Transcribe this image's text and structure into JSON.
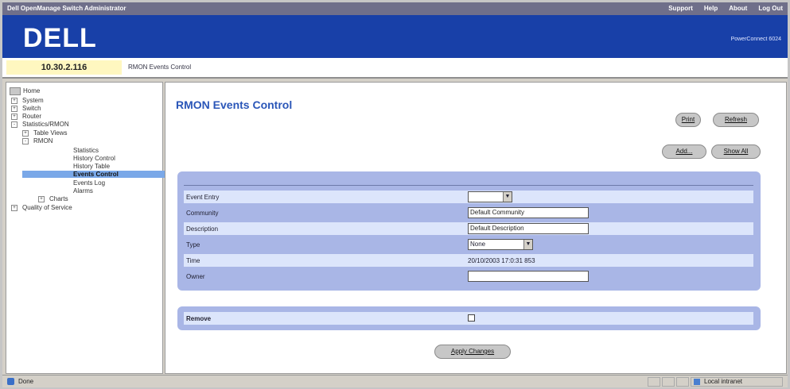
{
  "window": {
    "title": "Dell OpenManage Switch Administrator",
    "links": [
      "Support",
      "Help",
      "About",
      "Log Out"
    ]
  },
  "brand": {
    "logo": "DELL",
    "model": "PowerConnect 6024"
  },
  "address": {
    "ip": "10.30.2.116",
    "breadcrumb": "RMON Events Control"
  },
  "tree": {
    "root": "Home",
    "items": [
      {
        "label": "System",
        "expander": "+"
      },
      {
        "label": "Switch",
        "expander": "+"
      },
      {
        "label": "Router",
        "expander": "+"
      },
      {
        "label": "Statistics/RMON",
        "expander": "-"
      },
      {
        "label": "Table Views",
        "expander": "+"
      },
      {
        "label": "RMON",
        "expander": "-"
      },
      {
        "label": "Statistics"
      },
      {
        "label": "History Control"
      },
      {
        "label": "History Table"
      },
      {
        "label": "Events Control",
        "selected": true
      },
      {
        "label": "Events Log"
      },
      {
        "label": "Alarms"
      },
      {
        "label": "Charts",
        "expander": "+"
      },
      {
        "label": "Quality of Service",
        "expander": "+"
      }
    ]
  },
  "page": {
    "title": "RMON Events Control",
    "buttons": {
      "print": "Print",
      "refresh": "Refresh",
      "add": "Add...",
      "show_all": "Show All",
      "apply": "Apply Changes"
    }
  },
  "form": {
    "event_entry": {
      "label": "Event Entry",
      "value": ""
    },
    "community": {
      "label": "Community",
      "value": "Default Community"
    },
    "description": {
      "label": "Description",
      "value": "Default Description"
    },
    "type": {
      "label": "Type",
      "value": "None"
    },
    "time": {
      "label": "Time",
      "value": "20/10/2003 17:0:31 853"
    },
    "owner": {
      "label": "Owner",
      "value": ""
    },
    "remove": {
      "label": "Remove",
      "checked": false
    }
  },
  "statusbar": {
    "status": "Done",
    "zone": "Local intranet"
  }
}
